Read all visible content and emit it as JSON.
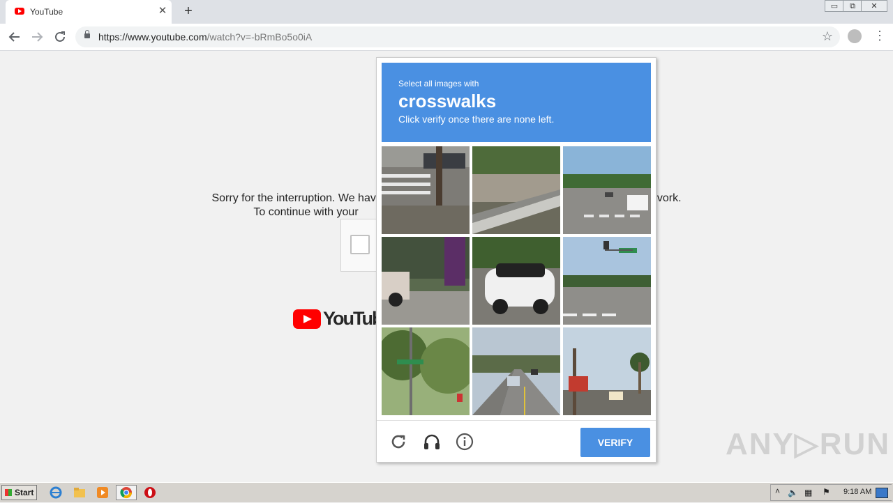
{
  "browser": {
    "tab_title": "YouTube",
    "tab_close": "✕",
    "new_tab": "+",
    "url_host": "https://www.youtube.com",
    "url_path": "/watch?v=-bRmBo5o0iA",
    "window_buttons": [
      "▭",
      "⧉",
      "✕"
    ]
  },
  "page": {
    "sorry_line1": "Sorry for the interruption. We hav",
    "sorry_line1_end": "vork.",
    "sorry_line2": "To continue with your",
    "logo_text": "YouTube"
  },
  "captcha": {
    "instruction_line1": "Select all images with",
    "keyword": "crosswalks",
    "instruction_line3": "Click verify once there are none left.",
    "tile_subjects": [
      "street corner with crosswalk and cone",
      "hillside and guardrail",
      "intersection with cars",
      "sidewalk with parked car",
      "white mini car",
      "intersection with traffic light",
      "trees with street sign",
      "road with cars",
      "palm trees and sign"
    ],
    "verify_label": "VERIFY",
    "footer_icons": [
      "reload-icon",
      "audio-icon",
      "info-icon"
    ],
    "accent_color": "#4a90e2"
  },
  "watermark": "ANY▷RUN",
  "taskbar": {
    "start_label": "Start",
    "clock": "9:18 AM",
    "tray_icons": [
      "show-hidden-icon",
      "volume-icon",
      "network-icon",
      "action-center-flag-icon",
      "show-desktop-icon"
    ]
  }
}
